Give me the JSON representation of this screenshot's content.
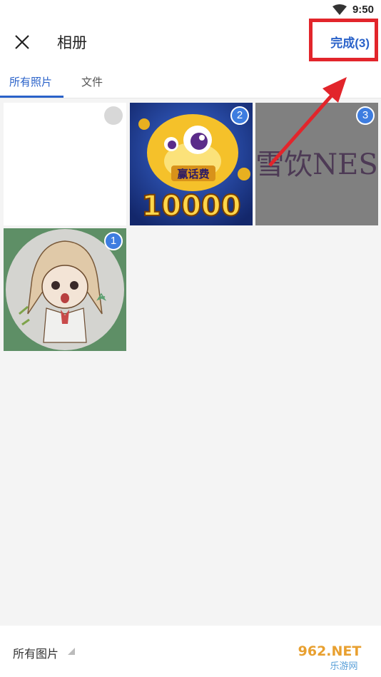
{
  "status_bar": {
    "time": "9:50",
    "wifi_icon": "wifi-icon"
  },
  "header": {
    "close_icon": "close-icon",
    "title": "相册",
    "done_label": "完成(3)"
  },
  "tabs": [
    {
      "label": "所有照片",
      "active": true
    },
    {
      "label": "文件",
      "active": false
    }
  ],
  "photos": [
    {
      "description": "blank white image",
      "selected": false,
      "order": ""
    },
    {
      "description": "game banner 赢话费 10000",
      "selected": true,
      "order": "2",
      "banner_text": "赢话费",
      "banner_number": "10000"
    },
    {
      "description": "text image 雪恢NES",
      "selected": true,
      "order": "3",
      "image_text": "雪饮NES"
    },
    {
      "description": "anime girl drawing",
      "selected": true,
      "order": "1"
    }
  ],
  "bottom_bar": {
    "album_label": "所有图片",
    "caret_icon": "triangle-icon"
  },
  "watermark": {
    "main": "962.NET",
    "sub": "乐游网"
  },
  "colors": {
    "accent": "#2a62c9",
    "highlight": "#e2252b",
    "badge": "#3e7de0"
  }
}
